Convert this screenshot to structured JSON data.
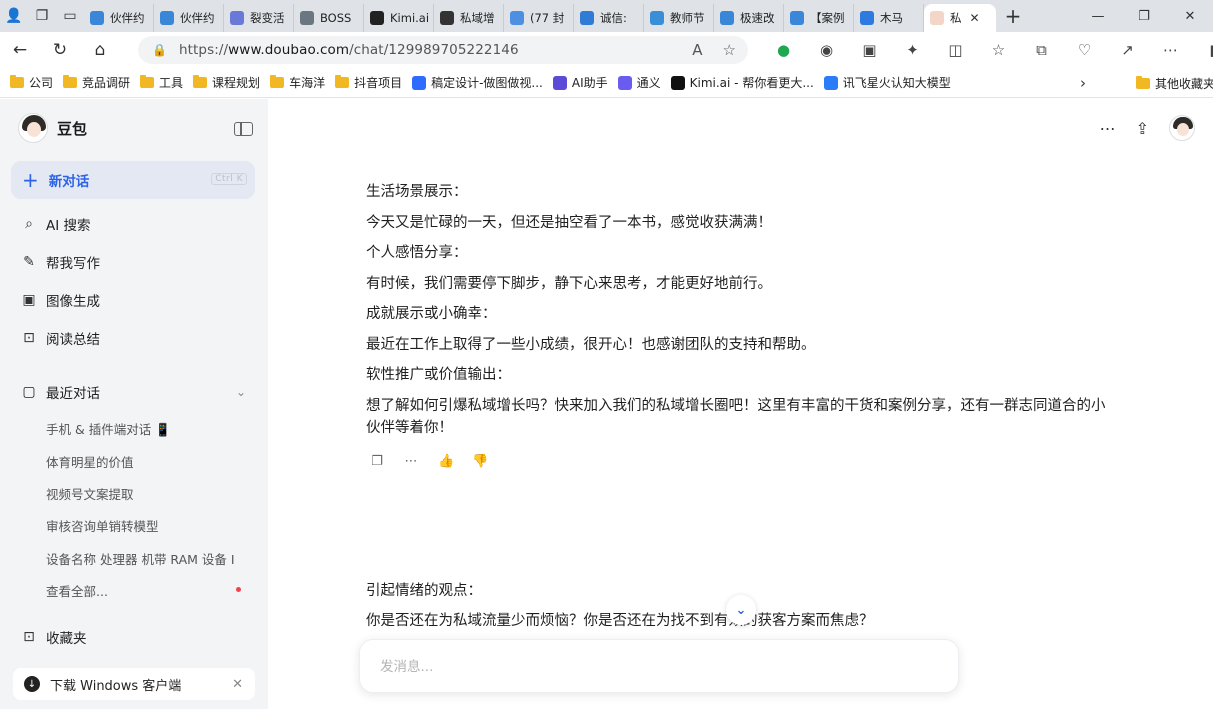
{
  "browser": {
    "tabs": [
      {
        "title": "伙伴约",
        "color": "#3a86d8"
      },
      {
        "title": "伙伴约",
        "color": "#3a86d8"
      },
      {
        "title": "裂变活",
        "color": "#6a78d8"
      },
      {
        "title": "BOSS",
        "color": "#6a7680"
      },
      {
        "title": "Kimi.ai",
        "color": "#222222"
      },
      {
        "title": "私域增",
        "color": "#333333"
      },
      {
        "title": "(77 封",
        "color": "#4d8fe0"
      },
      {
        "title": "诚信:",
        "color": "#2f7bd5"
      },
      {
        "title": "教师节",
        "color": "#3a8ed8"
      },
      {
        "title": "极速改",
        "color": "#3a86d8"
      },
      {
        "title": "【案例",
        "color": "#3a86d8"
      },
      {
        "title": "木马",
        "color": "#2d7be0"
      }
    ],
    "active_tab": {
      "title": "私"
    },
    "url_prefix": "https://",
    "url_host": "www.doubao.com",
    "url_path": "/chat/129989705222146",
    "bookmarks": [
      {
        "label": "公司",
        "type": "folder"
      },
      {
        "label": "竞品调研",
        "type": "folder"
      },
      {
        "label": "工具",
        "type": "folder"
      },
      {
        "label": "课程规划",
        "type": "folder"
      },
      {
        "label": "车海洋",
        "type": "folder"
      },
      {
        "label": "抖音项目",
        "type": "folder"
      },
      {
        "label": "稿定设计-做图做视...",
        "type": "site",
        "color": "#2f6bff"
      },
      {
        "label": "AI助手",
        "type": "site",
        "color": "#5b4bd6"
      },
      {
        "label": "通义",
        "type": "site",
        "color": "#6a5cf0"
      },
      {
        "label": "Kimi.ai - 帮你看更大...",
        "type": "site",
        "color": "#111111"
      },
      {
        "label": "讯飞星火认知大模型",
        "type": "site",
        "color": "#2b7cf6"
      }
    ],
    "other_bookmarks": "其他收藏夹"
  },
  "sidebar": {
    "brand": "豆包",
    "new_chat": {
      "label": "新对话",
      "shortcut": "Ctrl K"
    },
    "menu": [
      {
        "label": "AI 搜索",
        "icon": "search-icon"
      },
      {
        "label": "帮我写作",
        "icon": "pen-icon"
      },
      {
        "label": "图像生成",
        "icon": "image-icon"
      },
      {
        "label": "阅读总结",
        "icon": "book-icon"
      }
    ],
    "recent": {
      "title": "最近对话",
      "items": [
        "手机 & 插件端对话 📱",
        "体育明星的价值",
        "视频号文案提取",
        "审核咨询单销转模型",
        "设备名称 处理器 机带 RAM 设备 I",
        "查看全部..."
      ]
    },
    "favorites": "收藏夹",
    "download": "下载 Windows 客户端"
  },
  "chat": {
    "messages": [
      "生活场景展示：",
      "今天又是忙碌的一天，但还是抽空看了一本书，感觉收获满满！",
      "个人感悟分享：",
      "有时候，我们需要停下脚步，静下心来思考，才能更好地前行。",
      "成就展示或小确幸：",
      "最近在工作上取得了一些小成绩，很开心！也感谢团队的支持和帮助。",
      "软性推广或价值输出：",
      "想了解如何引爆私域增长吗？快来加入我们的私域增长圈吧！这里有丰富的干货和案例分享，还有一群志同道合的小伙伴等着你！"
    ],
    "messages2": [
      "引起情绪的观点：",
      "你是否还在为私域流量少而烦恼？你是否还在为找不到有效的获客方案而焦虑？"
    ],
    "composer_placeholder": "发消息..."
  }
}
